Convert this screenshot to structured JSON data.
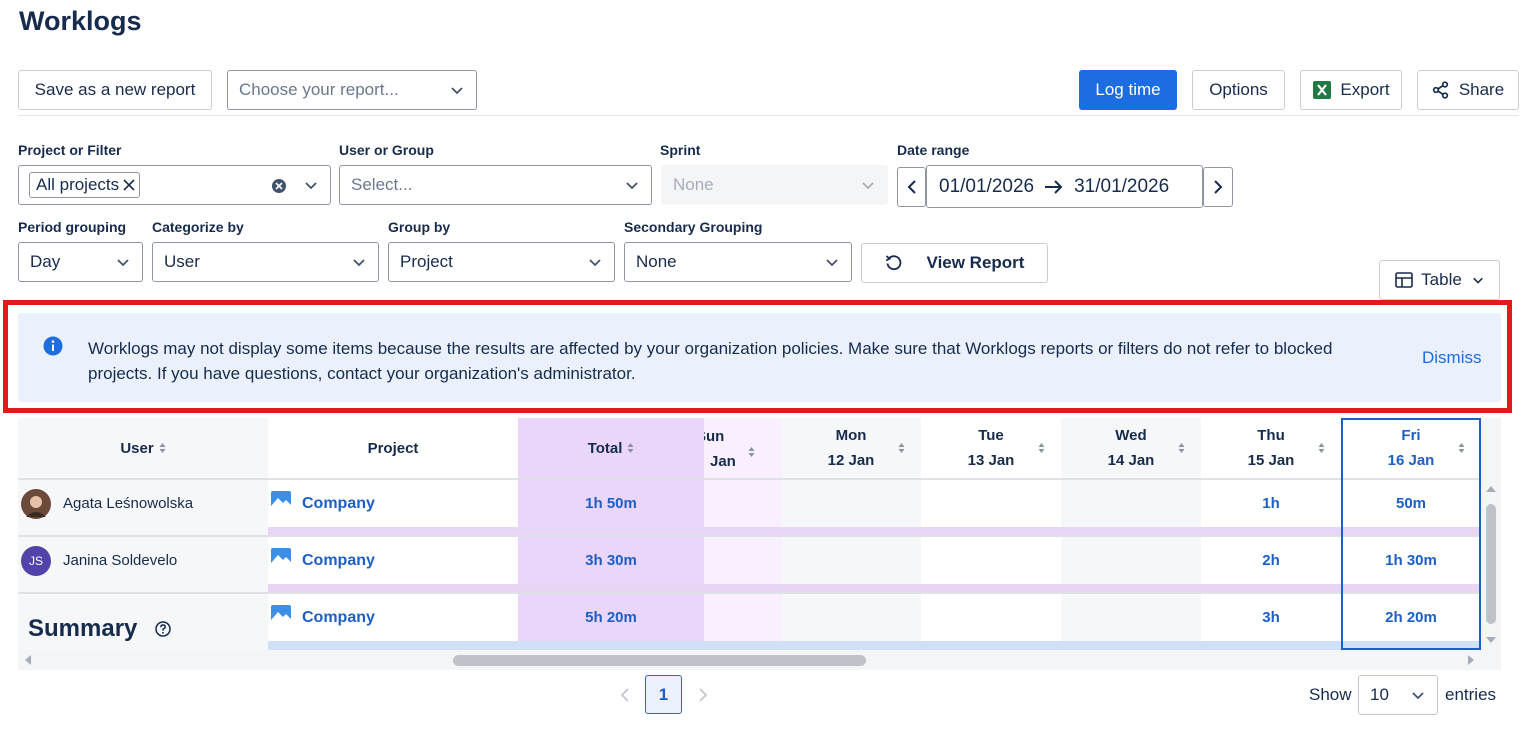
{
  "page": {
    "title": "Worklogs"
  },
  "toolbar": {
    "save_label": "Save as a new report",
    "report_placeholder": "Choose your report...",
    "log_time_label": "Log time",
    "options_label": "Options",
    "export_label": "Export",
    "share_label": "Share"
  },
  "filters": {
    "project_label": "Project or Filter",
    "project_tag": "All projects",
    "user_label": "User or Group",
    "user_placeholder": "Select...",
    "sprint_label": "Sprint",
    "sprint_value": "None",
    "date_label": "Date range",
    "date_start": "01/01/2026",
    "date_end": "31/01/2026",
    "period_label": "Period grouping",
    "period_value": "Day",
    "categorize_label": "Categorize by",
    "categorize_value": "User",
    "group_label": "Group by",
    "group_value": "Project",
    "secondary_label": "Secondary Grouping",
    "secondary_value": "None",
    "view_report_label": "View Report",
    "view_mode_label": "Table"
  },
  "banner": {
    "message": "Worklogs may not display some items because the results are affected by your organization policies. Make sure that Worklogs reports or filters do not refer to blocked projects. If you have questions, contact your organization's administrator.",
    "dismiss_label": "Dismiss"
  },
  "table": {
    "headers": {
      "user": "User",
      "project": "Project",
      "total": "Total",
      "days": [
        {
          "day": "Sun",
          "date": "Jan"
        },
        {
          "day": "Mon",
          "date": "12 Jan"
        },
        {
          "day": "Tue",
          "date": "13 Jan"
        },
        {
          "day": "Wed",
          "date": "14 Jan"
        },
        {
          "day": "Thu",
          "date": "15 Jan"
        },
        {
          "day": "Fri",
          "date": "16 Jan"
        }
      ]
    },
    "rows": [
      {
        "user": "Agata Leśnowolska",
        "avatar": "",
        "project": "Company",
        "total": "1h 50m",
        "values": [
          "",
          "",
          "",
          "",
          "1h",
          "50m"
        ]
      },
      {
        "user": "Janina Soldevelo",
        "avatar": "JS",
        "project": "Company",
        "total": "3h 30m",
        "values": [
          "",
          "",
          "",
          "",
          "2h",
          "1h 30m"
        ]
      }
    ],
    "summary": {
      "label": "Summary",
      "project": "Company",
      "total": "5h 20m",
      "values": [
        "",
        "",
        "",
        "",
        "3h",
        "2h 20m"
      ]
    }
  },
  "pagination": {
    "current_page": "1",
    "show_label": "Show",
    "page_size": "10",
    "entries_label": "entries"
  },
  "colors": {
    "primary": "#1d6de0",
    "link": "#1d5fc4",
    "banner_bg": "#eaf1fc",
    "highlight_outline": "#e21a1a",
    "total_column": "#ead5fb"
  }
}
